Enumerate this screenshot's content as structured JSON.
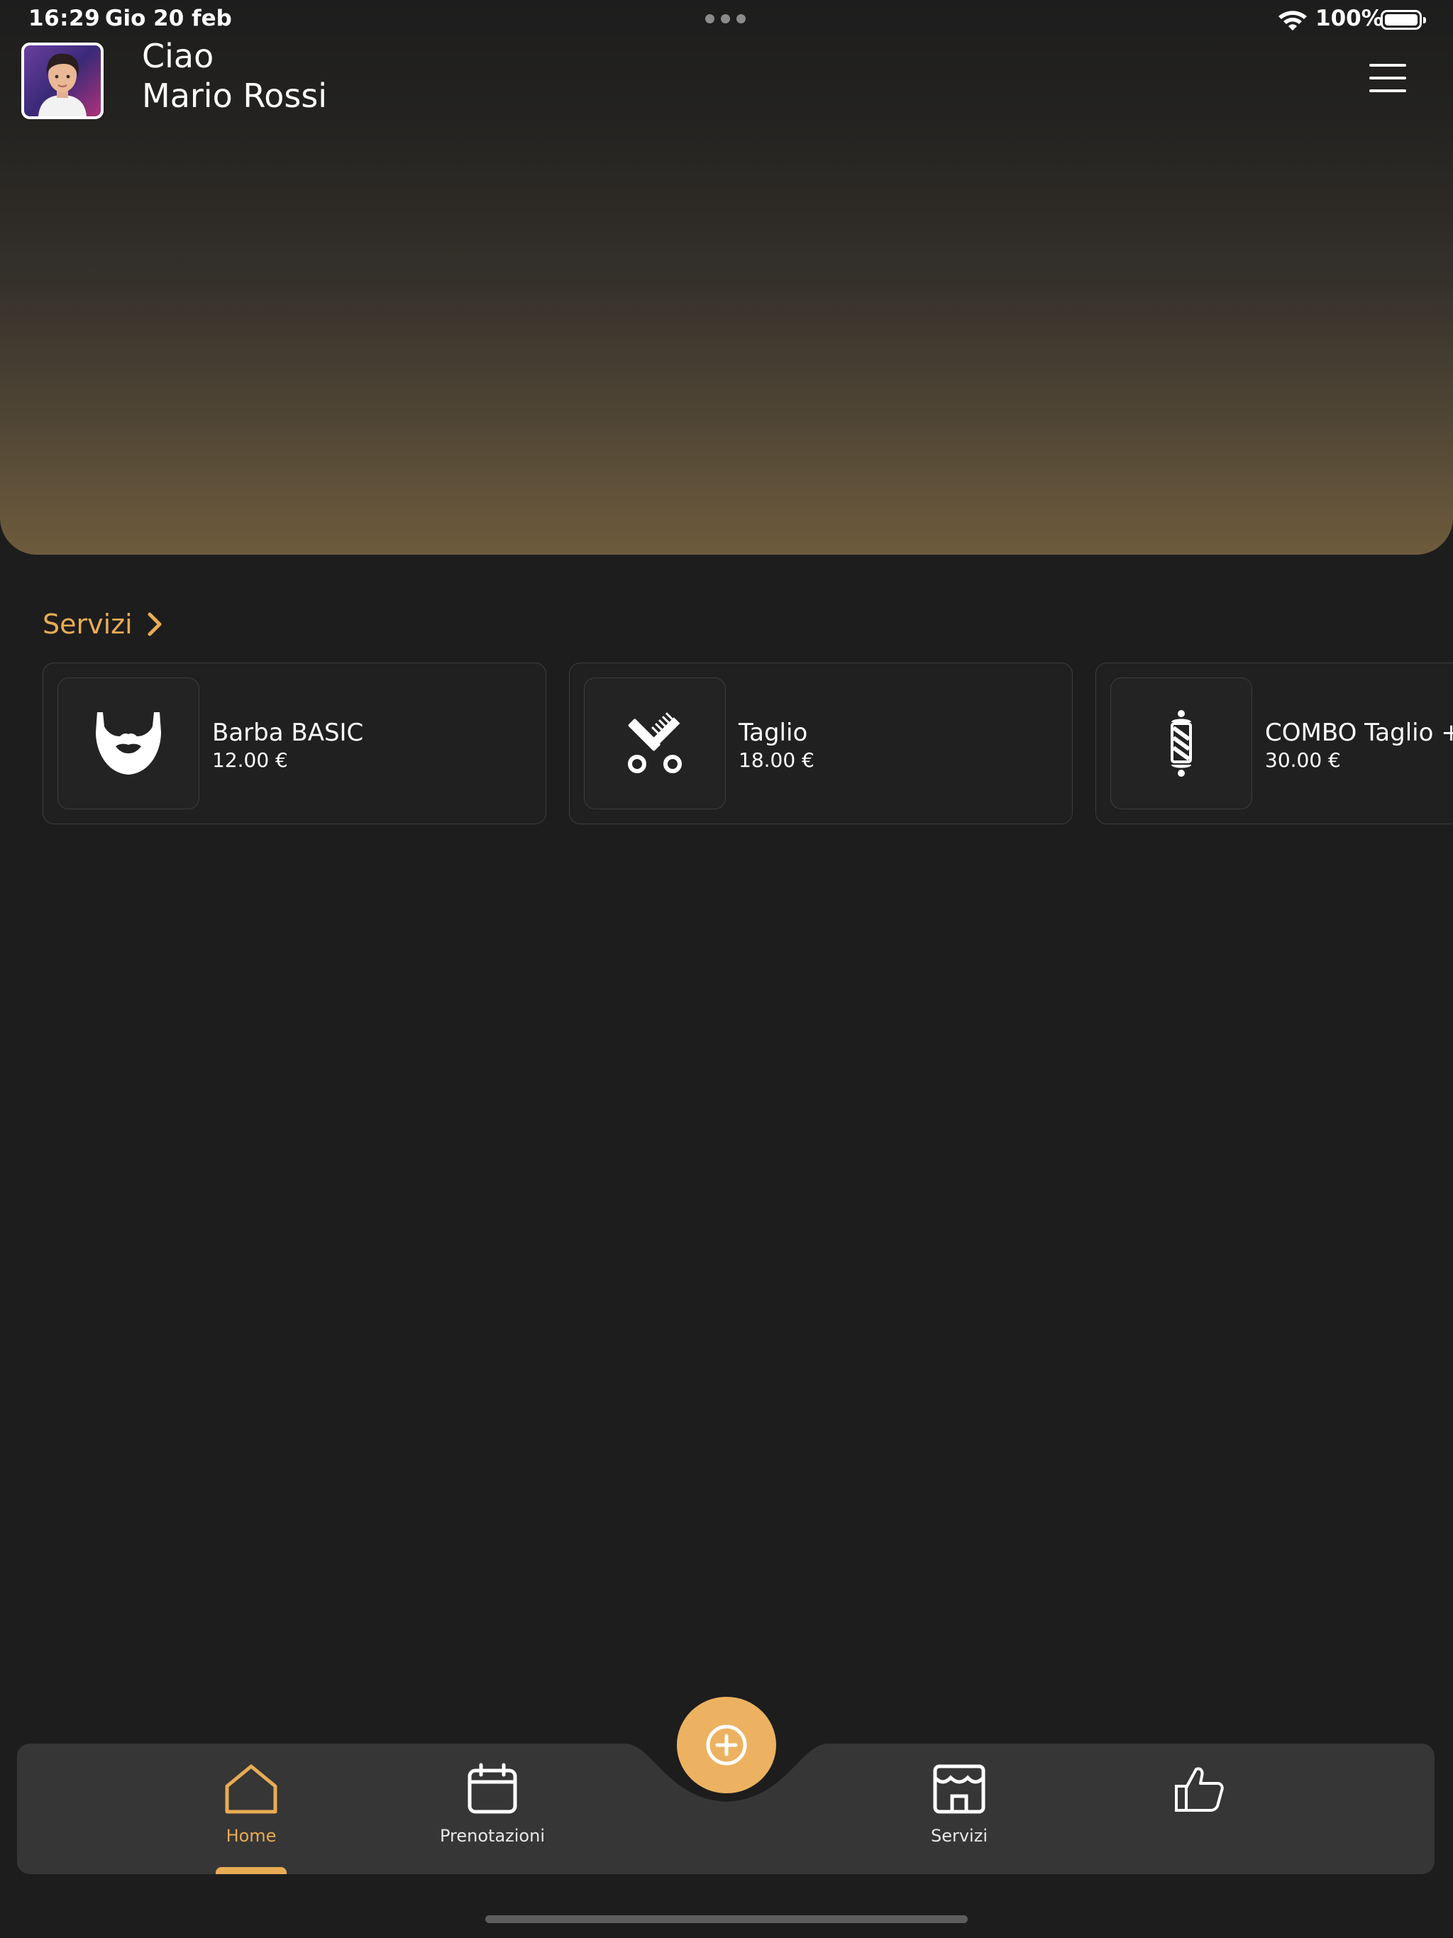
{
  "status_bar": {
    "time": "16:29",
    "date": "Gio 20 feb",
    "battery": "100%"
  },
  "header": {
    "greeting": "Ciao",
    "user_name": "Mario Rossi",
    "avatar_icon": "user-avatar",
    "menu_icon": "hamburger-menu-icon"
  },
  "services": {
    "title": "Servizi",
    "items": [
      {
        "name": "Barba BASIC",
        "price": "12.00 €",
        "icon": "beard-icon"
      },
      {
        "name": "Taglio",
        "price": "18.00 €",
        "icon": "comb-scissors-icon"
      },
      {
        "name": "COMBO Taglio +",
        "price": "30.00 €",
        "icon": "barber-pole-icon"
      }
    ]
  },
  "bottom_nav": {
    "items": [
      {
        "label": "Home",
        "icon": "home-icon",
        "active": true
      },
      {
        "label": "Prenotazioni",
        "icon": "calendar-icon",
        "active": false
      },
      {
        "label": "Servizi",
        "icon": "shop-icon",
        "active": false
      },
      {
        "label": "",
        "icon": "thumbs-up-icon",
        "active": false
      }
    ],
    "fab_icon": "plus-circle-icon"
  },
  "colors": {
    "accent": "#e8ac55",
    "background": "#1d1d1d",
    "card_background": "#202020",
    "nav_background": "#363636"
  }
}
